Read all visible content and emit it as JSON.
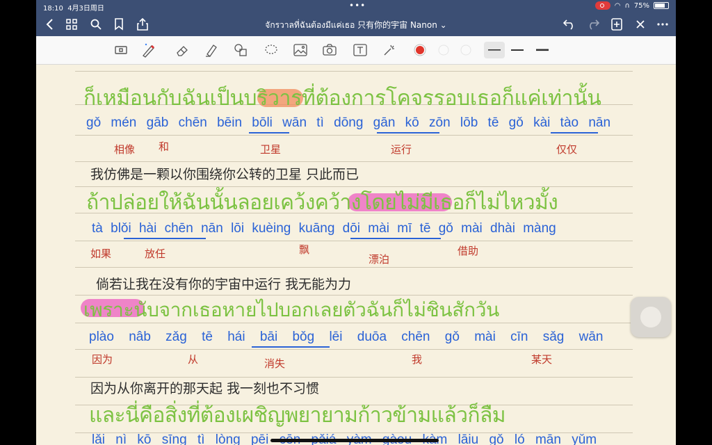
{
  "status": {
    "time": "18:10",
    "date": "4月3日周日",
    "dots": "•••",
    "battery": "75%",
    "battery_level": 0.75
  },
  "nav": {
    "title": "จักรวาลที่ฉันต้องมีแค่เธอ 只有你的宇宙 Nanon ⌄"
  },
  "colors": {
    "navbar": "#3c4f74",
    "thai_green": "#7cc242",
    "thai_pink": "#c239c0",
    "romanization": "#2a62d6",
    "chinese": "#c0392b",
    "highlight_orange": "#f28c5e",
    "highlight_pink": "#ec5fc0"
  },
  "notebook": {
    "thai_lines": [
      "ก็เหมือนกับฉันเป็นบริวารที่ต้องการโคจรรอบเธอก็แค่เท่านั้น",
      "ถ้าปล่อยให้ฉันนั้นลอยเคว้งคว้างโดยไม่มีเธอก็ไม่ไหวมั้ง",
      "เพราะนับจากเธอหายไปบอกเลยตัวฉันก็ไม่ชินสักวัน",
      "และนี่คือสิ่งที่ต้องเผชิญพยายามก้าวข้ามแล้วก็ลืม"
    ],
    "rom_lines": [
      "gǒ mén gāb chēn bēin bōli wān tì dōng gān kō zōn lōb tē gǒ kài tào nān",
      "tà blǒi hài chēn nān lōi kuèing kuāng dōi mài mī tē gǒ mài dhài màng",
      "plào nâb zǎg tē hái bāi bǒg lēi duōa chēn gǒ mài cīn sǎg wān",
      "lǎi nì kō sīng tì lòng pēi cēn pǎiá yàm gàou kàm lāiu gǒ ló mān yǔm"
    ],
    "cn_annotations": [
      [
        "相像",
        "和",
        "卫星",
        "运行",
        "仅仅"
      ],
      [
        "如果",
        "放任",
        "飘",
        "漂泊",
        "借助"
      ],
      [
        "因为",
        "从",
        "消失",
        "我",
        "某天"
      ]
    ],
    "chinese_notes": [
      "我仿佛是一颗以你围绕你公转的卫星 只此而已",
      "倘若让我在没有你的宇宙中运行 我无能为力",
      "因为从你离开的那天起 我一刻也不习惯"
    ]
  }
}
